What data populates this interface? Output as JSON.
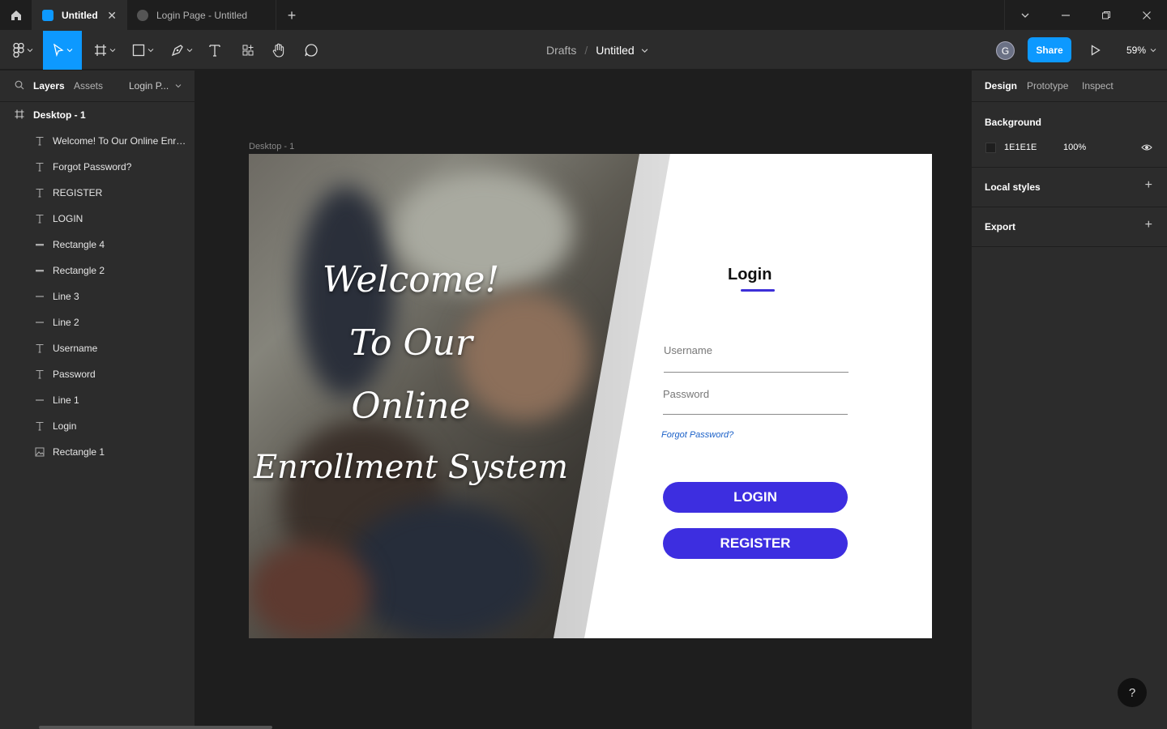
{
  "tabs": [
    {
      "label": "Untitled",
      "active": true
    },
    {
      "label": "Login Page - Untitled",
      "active": false
    }
  ],
  "toolbar": {
    "drafts": "Drafts",
    "separator": "/",
    "file_name": "Untitled",
    "avatar_initial": "G",
    "share_label": "Share",
    "zoom_level": "59%"
  },
  "left_panel": {
    "tabs": [
      "Layers",
      "Assets"
    ],
    "page": "Login P...",
    "root_layer": "Desktop - 1",
    "layers": [
      {
        "name": "Welcome! To Our Online Enroll...",
        "icon": "text-icon"
      },
      {
        "name": "Forgot Password?",
        "icon": "text-icon"
      },
      {
        "name": "REGISTER",
        "icon": "text-icon"
      },
      {
        "name": "LOGIN",
        "icon": "text-icon"
      },
      {
        "name": "Rectangle 4",
        "icon": "rectangle-icon"
      },
      {
        "name": "Rectangle 2",
        "icon": "rectangle-icon"
      },
      {
        "name": "Line 3",
        "icon": "line-icon"
      },
      {
        "name": "Line 2",
        "icon": "line-icon"
      },
      {
        "name": "Username",
        "icon": "text-icon"
      },
      {
        "name": "Password",
        "icon": "text-icon"
      },
      {
        "name": "Line 1",
        "icon": "line-icon"
      },
      {
        "name": "Login",
        "icon": "text-icon"
      },
      {
        "name": "Rectangle 1",
        "icon": "image-icon"
      }
    ]
  },
  "right_panel": {
    "tabs": [
      "Design",
      "Prototype",
      "Inspect"
    ],
    "background_title": "Background",
    "background_hex": "1E1E1E",
    "background_opacity": "100%",
    "local_styles": "Local styles",
    "export": "Export"
  },
  "canvas": {
    "frame_label": "Desktop - 1",
    "welcome_lines": [
      "Welcome!",
      "To Our",
      "Online",
      "Enrollment System"
    ],
    "login_title": "Login",
    "username_label": "Username",
    "password_label": "Password",
    "forgot_password": "Forgot Password?",
    "login_button": "LOGIN",
    "register_button": "REGISTER"
  },
  "help_label": "?",
  "colors": {
    "accent": "#0d99ff",
    "button": "#3d2ee0",
    "link": "#1a60c8",
    "background": "#1e1e1e"
  }
}
